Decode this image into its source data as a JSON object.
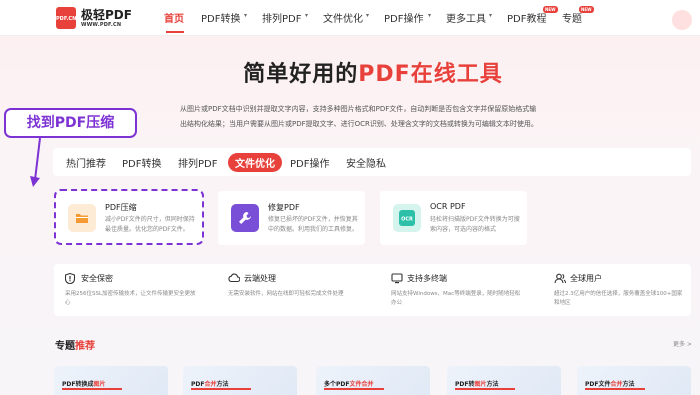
{
  "brand": {
    "name": "极轻PDF",
    "url": "WWW.PDF.CN",
    "logo_text": "PDF.CN",
    "color": "#e8413b"
  },
  "nav": {
    "items": [
      {
        "label": "首页"
      },
      {
        "label": "PDF转换"
      },
      {
        "label": "排列PDF"
      },
      {
        "label": "文件优化"
      },
      {
        "label": "PDF操作"
      },
      {
        "label": "更多工具"
      },
      {
        "label": "PDF教程"
      },
      {
        "label": "专题"
      }
    ],
    "new_badge": "NEW"
  },
  "hero": {
    "title_main": "简单好用的",
    "title_accent": "PDF在线工具",
    "desc_line1": "从图片或PDF文档中识别并提取文字内容，支持多种图片格式和PDF文件，自动判断是否包含文字并保留原始格式输",
    "desc_line2": "出结构化结果；当用户需要从图片或PDF提取文字、进行OCR识别、处理含文字的文档或转换为可编辑文本时使用。"
  },
  "callout": {
    "text": "找到PDF压缩",
    "color": "#7d33d4"
  },
  "tabs": [
    {
      "label": "热门推荐"
    },
    {
      "label": "PDF转换"
    },
    {
      "label": "排列PDF"
    },
    {
      "label": "文件优化"
    },
    {
      "label": "PDF操作"
    },
    {
      "label": "安全隐私"
    }
  ],
  "tools": [
    {
      "name": "PDF压缩",
      "desc": "减小PDF文件的尺寸，但同时保持最佳质量。优化您的PDF文件。",
      "icon": "folder-icon",
      "color": "#f39a33"
    },
    {
      "name": "修复PDF",
      "desc": "修复已损坏的PDF文件，并恢复其中的数据。利用我们的工具修复。",
      "icon": "wrench-icon",
      "color": "#7a4fd8"
    },
    {
      "name": "OCR PDF",
      "desc": "轻松将扫描版PDF文件转换为可搜索内容，可选内容的格式",
      "icon": "ocr-icon",
      "color": "#2cc0a8"
    }
  ],
  "features": [
    {
      "title": "安全保密",
      "desc": "采用256位SSL加密传输技术，让文件传输更安全更放心",
      "icon": "shield-icon"
    },
    {
      "title": "云端处理",
      "desc": "无需安装软件，网站在线即可轻松完成文件处理",
      "icon": "cloud-icon"
    },
    {
      "title": "支持多终端",
      "desc": "网站支持Windows、Mac等终端登录，随时随地轻松办公",
      "icon": "monitor-icon"
    },
    {
      "title": "全球用户",
      "desc": "超过2.3亿用户的信任选择，服务覆盖全球100+国家和地区",
      "icon": "users-icon"
    }
  ],
  "topics": {
    "title_main": "专题",
    "title_accent": "推荐",
    "more": "更多 >",
    "cards": [
      {
        "prefix": "PDF转换成",
        "highlight": "图片"
      },
      {
        "prefix": "PDF",
        "highlight": "合并",
        "suffix": "方法"
      },
      {
        "prefix": "多个PDF",
        "highlight": "文件合并"
      },
      {
        "prefix": "PDF转",
        "highlight": "图片",
        "suffix": "方法"
      },
      {
        "prefix": "PDF文件",
        "highlight": "合并",
        "suffix": "方法"
      }
    ]
  }
}
